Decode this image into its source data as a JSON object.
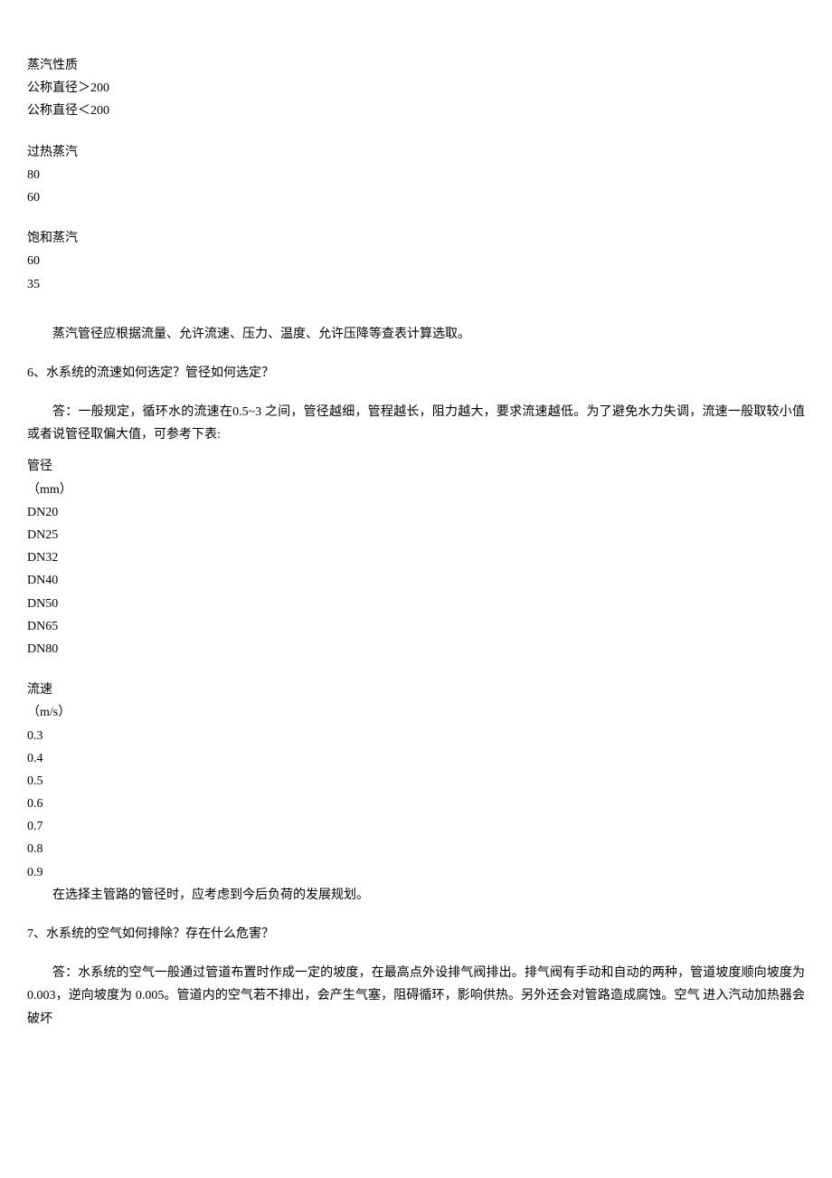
{
  "table1": {
    "header": {
      "col1": "蒸汽性质",
      "col2": "公称直径＞200",
      "col3": "公称直径＜200"
    },
    "row1": {
      "label": "过热蒸汽",
      "v1": "80",
      "v2": "60"
    },
    "row2": {
      "label": "饱和蒸汽",
      "v1": "60",
      "v2": "35"
    }
  },
  "note1": "蒸汽管径应根据流量、允许流速、压力、温度、允许压降等查表计算选取。",
  "q6": {
    "title": "6、水系统的流速如何选定？管径如何选定？",
    "answer": "答：一般规定，循环水的流速在0.5~3 之间，管径越细，管程越长，阻力越大，要求流速越低。为了避免水力失调，流速一般取较小值 或者说管径取偏大值，可参考下表:"
  },
  "table2": {
    "dia_label": "管径",
    "dia_unit": "（mm）",
    "dia": [
      "DN20",
      "DN25",
      "DN32",
      "DN40",
      "DN50",
      "DN65",
      "DN80"
    ],
    "speed_label": "流速",
    "speed_unit": "（m/s）",
    "speed": [
      "0.3",
      "0.4",
      "0.5",
      "0.6",
      "0.7",
      "0.8",
      "0.9"
    ]
  },
  "note2": "在选择主管路的管径时，应考虑到今后负荷的发展规划。",
  "q7": {
    "title": "7、水系统的空气如何排除？存在什么危害？",
    "answer": "答：水系统的空气一般通过管道布置时作成一定的坡度，在最高点外设排气阀排出。排气阀有手动和自动的两种，管道坡度顺向坡度为 0.003，逆向坡度为 0.005。管道内的空气若不排出，会产生气塞，阻碍循环，影响供热。另外还会对管路造成腐蚀。空气 进入汽动加热器会 破坏"
  }
}
